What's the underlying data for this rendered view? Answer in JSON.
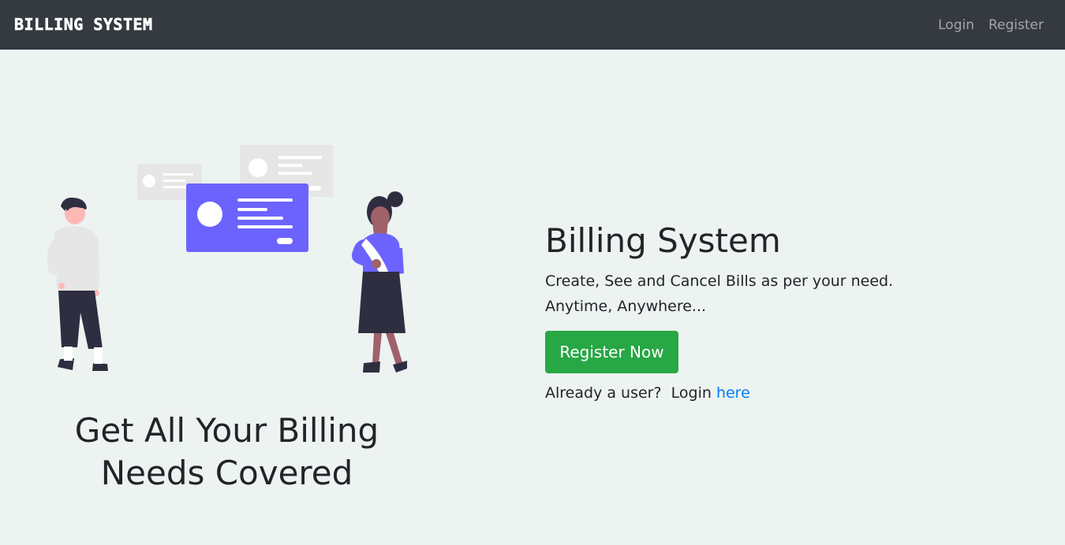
{
  "navbar": {
    "brand": "Billing System",
    "links": [
      {
        "label": "Login"
      },
      {
        "label": "Register"
      }
    ]
  },
  "hero": {
    "tagline_line1": "Get All Your Billing",
    "tagline_line2": "Needs Covered",
    "title": "Billing System",
    "description_line1": "Create, See and Cancel Bills as per your need.",
    "description_line2": "Anytime, Anywhere...",
    "cta_label": "Register Now",
    "login_prompt": "Already a user?  Login ",
    "login_link": "here"
  },
  "illustration": {
    "name": "people-with-cards-illustration",
    "accent_color": "#6c63ff",
    "card_color": "#e6e6e6",
    "dark_color": "#2f2e41",
    "skin_light": "#ffb8b8",
    "skin_dark": "#a0616a"
  },
  "colors": {
    "navbar_bg": "#343a40",
    "page_bg": "#ecf3f1",
    "cta_bg": "#28a745",
    "link": "#007bff"
  }
}
